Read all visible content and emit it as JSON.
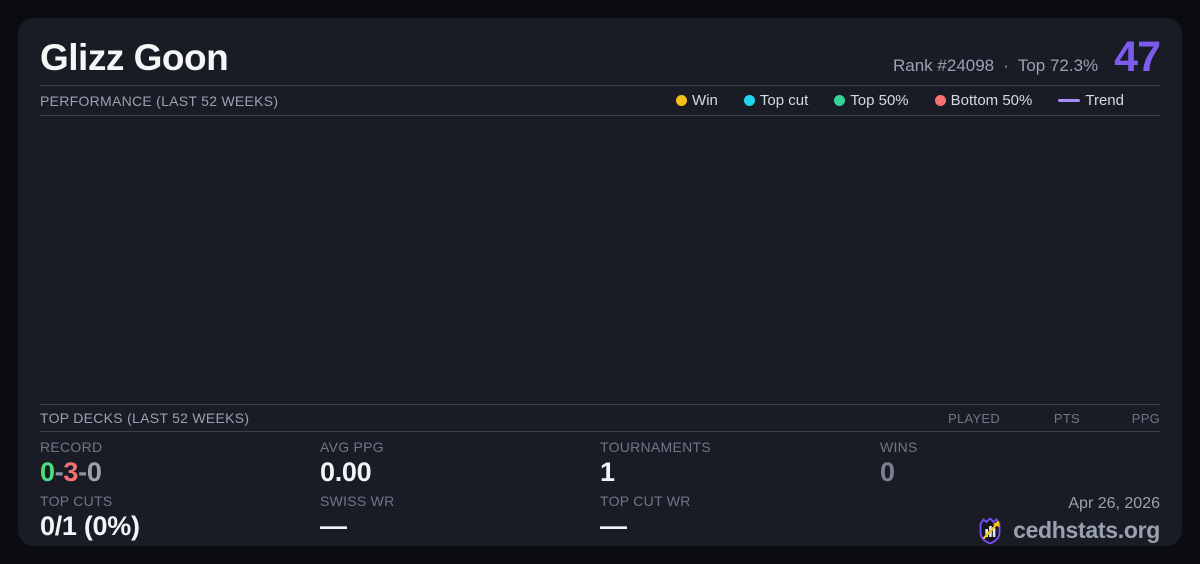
{
  "colors": {
    "accent": "#7e5bef",
    "record_win": "#4ade80",
    "record_loss": "#f87171",
    "record_draw": "#9ca3af",
    "muted_value": "#79818f",
    "brand_purple": "#7c4dff",
    "arrow_gold": "#f5c518",
    "bar_white": "#e8eaee"
  },
  "header": {
    "title": "Glizz Goon",
    "rank": "Rank #24098",
    "separator": "·",
    "percentile": "Top 72.3%",
    "score": "47"
  },
  "performance": {
    "label": "PERFORMANCE (LAST 52 WEEKS)",
    "legend": [
      {
        "label": "Win",
        "color": "#f2c019"
      },
      {
        "label": "Top cut",
        "color": "#22d3ee"
      },
      {
        "label": "Top 50%",
        "color": "#34d399"
      },
      {
        "label": "Bottom 50%",
        "color": "#f87171"
      },
      {
        "label": "Trend",
        "color": "#a78bfa"
      }
    ]
  },
  "chart_data": {
    "type": "scatter",
    "title": "PERFORMANCE (LAST 52 WEEKS)",
    "series": [
      {
        "name": "Win",
        "points": []
      },
      {
        "name": "Top cut",
        "points": []
      },
      {
        "name": "Top 50%",
        "points": []
      },
      {
        "name": "Bottom 50%",
        "points": []
      },
      {
        "name": "Trend",
        "points": []
      }
    ],
    "legend_position": "top-right",
    "grid": false,
    "note": "chart plot area is empty in the screenshot"
  },
  "top_decks": {
    "label": "TOP DECKS (LAST 52 WEEKS)",
    "columns": [
      "PLAYED",
      "PTS",
      "PPG"
    ],
    "rows": []
  },
  "stats": {
    "record": {
      "label": "RECORD",
      "wins": "0",
      "losses": "3",
      "draws": "0",
      "dash": "-"
    },
    "avg_ppg": {
      "label": "AVG PPG",
      "value": "0.00"
    },
    "tournaments": {
      "label": "TOURNAMENTS",
      "value": "1"
    },
    "wins": {
      "label": "WINS",
      "value": "0"
    },
    "top_cuts": {
      "label": "TOP CUTS",
      "value": "0/1 (0%)"
    },
    "swiss_wr": {
      "label": "SWISS WR",
      "value": "—"
    },
    "top_cut_wr": {
      "label": "TOP CUT WR",
      "value": "—"
    }
  },
  "footer": {
    "date": "Apr 26, 2026",
    "brand": "cedhstats.org"
  }
}
